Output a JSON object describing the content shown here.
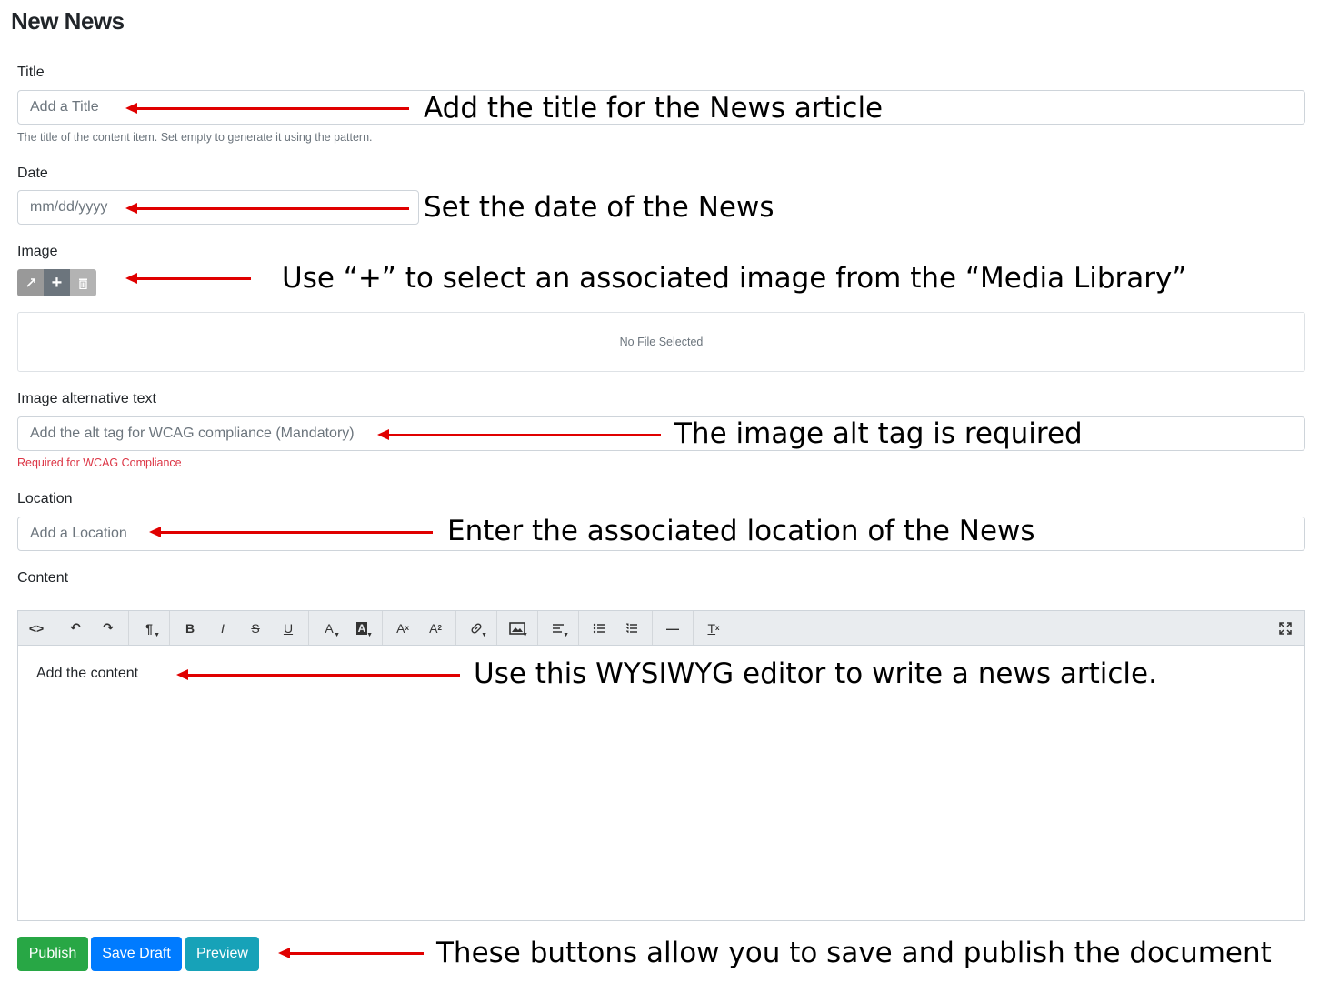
{
  "page": {
    "title": "New News"
  },
  "fields": {
    "title": {
      "label": "Title",
      "placeholder": "Add a Title",
      "hint": "The title of the content item. Set empty to generate it using the pattern."
    },
    "date": {
      "label": "Date",
      "placeholder": "mm/dd/yyyy"
    },
    "image": {
      "label": "Image",
      "no_file": "No File Selected"
    },
    "alt_text": {
      "label": "Image alternative text",
      "placeholder": "Add the alt tag for WCAG compliance (Mandatory)",
      "hint": "Required for WCAG Compliance"
    },
    "location": {
      "label": "Location",
      "placeholder": "Add a Location"
    },
    "content": {
      "label": "Content",
      "placeholder": "Add the content"
    }
  },
  "toolbar": {
    "code": "<>",
    "undo": "↶",
    "redo": "↷",
    "paragraph": "¶",
    "bold": "B",
    "italic": "I",
    "strike": "S",
    "underline": "U",
    "font_color": "A",
    "bg_color": "A",
    "superscript": "A",
    "subscript": "A",
    "link": "🔗",
    "image": "🖼",
    "align": "≡",
    "ul": "☰",
    "ol": "☰",
    "hr": "—",
    "clear": "T",
    "fullscreen": "⛶"
  },
  "buttons": {
    "publish": "Publish",
    "save_draft": "Save Draft",
    "preview": "Preview"
  },
  "annotations": {
    "title": "Add the title for the News article",
    "date": "Set the date of the News",
    "image": "Use “+” to select an associated image from the “Media Library”",
    "alt": "The image alt tag is required",
    "location": "Enter the associated location of the News",
    "content": "Use this WYSIWYG editor to write a news article.",
    "buttons": "These buttons allow you to save and publish the document"
  },
  "colors": {
    "annotation_arrow": "#e00000",
    "publish": "#28a745",
    "save_draft": "#007bff",
    "preview": "#17a2b8",
    "error_text": "#dc3545"
  }
}
